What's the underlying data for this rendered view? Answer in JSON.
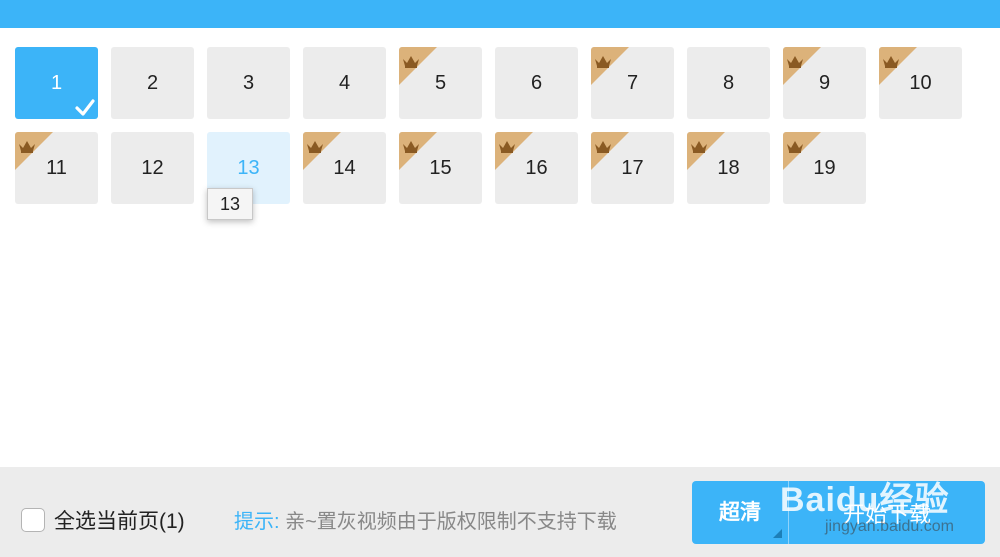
{
  "episodes": {
    "row1": [
      {
        "label": "1",
        "state": "selected",
        "vip": false
      },
      {
        "label": "2",
        "state": "normal",
        "vip": false
      },
      {
        "label": "3",
        "state": "normal",
        "vip": false
      },
      {
        "label": "4",
        "state": "normal",
        "vip": false
      },
      {
        "label": "5",
        "state": "normal",
        "vip": true
      },
      {
        "label": "6",
        "state": "normal",
        "vip": false
      },
      {
        "label": "7",
        "state": "normal",
        "vip": true
      },
      {
        "label": "8",
        "state": "normal",
        "vip": false
      },
      {
        "label": "9",
        "state": "normal",
        "vip": true
      },
      {
        "label": "10",
        "state": "normal",
        "vip": true
      }
    ],
    "row2": [
      {
        "label": "11",
        "state": "normal",
        "vip": true
      },
      {
        "label": "12",
        "state": "normal",
        "vip": false
      },
      {
        "label": "13",
        "state": "hover",
        "vip": false
      },
      {
        "label": "14",
        "state": "normal",
        "vip": true
      },
      {
        "label": "15",
        "state": "normal",
        "vip": true
      },
      {
        "label": "16",
        "state": "normal",
        "vip": true
      },
      {
        "label": "17",
        "state": "normal",
        "vip": true
      },
      {
        "label": "18",
        "state": "normal",
        "vip": true
      },
      {
        "label": "19",
        "state": "normal",
        "vip": true
      }
    ]
  },
  "tooltip": {
    "text": "13"
  },
  "footer": {
    "select_all_label": "全选当前页(1)",
    "tip_key": "提示:",
    "tip_text": "亲~置灰视频由于版权限制不支持下载",
    "quality_label": "超清",
    "download_label": "开始下载"
  },
  "watermark": {
    "logo": "Baidu经验",
    "sub": "jingyan.baidu.com"
  },
  "colors": {
    "accent": "#3cb4f8",
    "vip_corner": "#dcb27a",
    "crown": "#8a5a23",
    "tile_bg": "#ececec"
  },
  "icons": {
    "vip": "crown-icon",
    "selected": "checkmark-icon"
  }
}
